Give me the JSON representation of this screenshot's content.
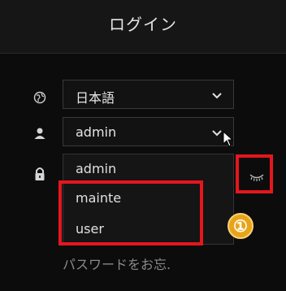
{
  "header": {
    "title": "ログイン"
  },
  "language": {
    "value": "日本語",
    "icon": "globe-icon"
  },
  "user": {
    "value": "admin",
    "icon": "user-icon"
  },
  "password": {
    "icon": "lock-icon",
    "eye_icon": "eye-closed-icon"
  },
  "dropdown": {
    "options": [
      "admin",
      "mainte",
      "user"
    ]
  },
  "forgot": {
    "text": "パスワードをお忘."
  },
  "annotation": {
    "badge": "①",
    "highlight_color": "#e5161d"
  }
}
